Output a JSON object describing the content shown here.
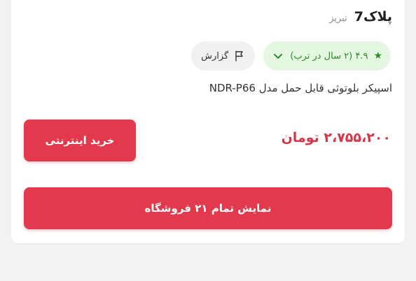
{
  "shop": {
    "name": "پلاک7",
    "city": "تبریز"
  },
  "rating": {
    "star": "★",
    "text": "۴.۹ (۲ سال در ترب)"
  },
  "report": {
    "label": "گزارش"
  },
  "product": {
    "title": "اسپیکر بلوتوثی قابل حمل مدل NDR-P66"
  },
  "price": {
    "text": "۲،۷۵۵،۲۰۰ تومان"
  },
  "buttons": {
    "buy_online": "خرید اینترنتی",
    "show_all_stores": "نمایش تمام ۲۱ فروشگاه"
  },
  "colors": {
    "accent_red": "#e2394d",
    "rating_green": "#2e8a2a",
    "rating_bg": "#e3f7e1"
  },
  "icons": {
    "rating_expand": "chevron-down-icon",
    "report": "flag-icon"
  }
}
